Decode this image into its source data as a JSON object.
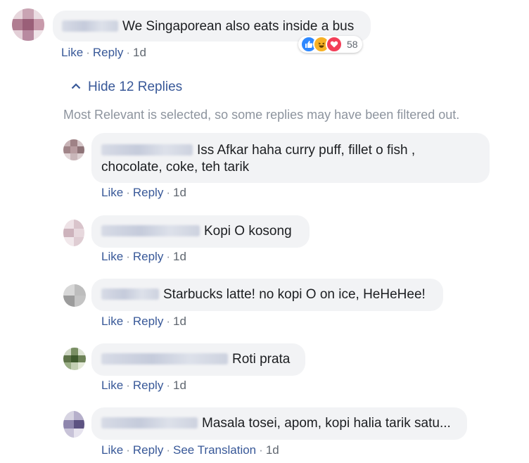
{
  "top_comment": {
    "text": "We Singaporean also eats inside a bus",
    "actions": {
      "like": "Like",
      "reply": "Reply",
      "time": "1d"
    },
    "reactions": {
      "count": "58",
      "icons": [
        "like-icon",
        "haha-icon",
        "love-icon"
      ]
    }
  },
  "replies_toggle": {
    "label": "Hide 12 Replies",
    "icon": "chevron-up-icon"
  },
  "filter_notice": "Most Relevant is selected, so some replies may have been filtered out.",
  "replies": [
    {
      "line1": "Iss Afkar haha curry puff, fillet o fish ,",
      "line2": "chocolate, coke, teh tarik",
      "like": "Like",
      "reply": "Reply",
      "time": "1d"
    },
    {
      "text": "Kopi O kosong",
      "like": "Like",
      "reply": "Reply",
      "time": "1d"
    },
    {
      "text": "Starbucks latte! no kopi O on ice, HeHeHee!",
      "like": "Like",
      "reply": "Reply",
      "time": "1d"
    },
    {
      "text": "Roti prata",
      "like": "Like",
      "reply": "Reply",
      "time": "1d"
    },
    {
      "text": "Masala tosei, apom, kopi halia tarik satu...",
      "like": "Like",
      "reply": "Reply",
      "translate": "See Translation",
      "time": "1d"
    }
  ],
  "colors": {
    "link": "#385898",
    "bubble": "#f2f3f5",
    "meta": "#606770",
    "like": "#2d88ff",
    "love": "#f33e58",
    "haha": "#f7b125"
  }
}
